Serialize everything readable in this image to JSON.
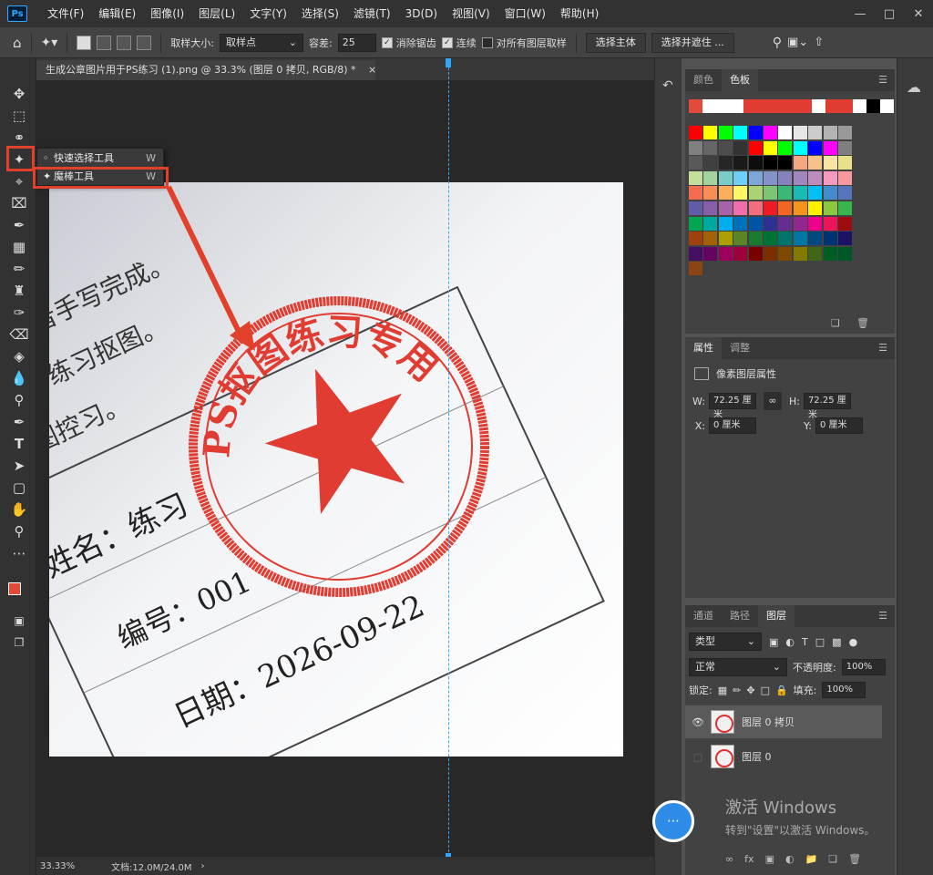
{
  "menubar": {
    "logo": "Ps",
    "items": [
      "文件(F)",
      "编辑(E)",
      "图像(I)",
      "图层(L)",
      "文字(Y)",
      "选择(S)",
      "滤镜(T)",
      "3D(D)",
      "视图(V)",
      "窗口(W)",
      "帮助(H)"
    ]
  },
  "options": {
    "sample_size_label": "取样大小:",
    "sample_size_value": "取样点",
    "tolerance_label": "容差:",
    "tolerance_value": "25",
    "antialias_label": "消除锯齿",
    "antialias_checked": true,
    "contiguous_label": "连续",
    "contiguous_checked": true,
    "all_layers_label": "对所有图层取样",
    "all_layers_checked": false,
    "select_subject": "选择主体",
    "select_mask": "选择并遮住 ..."
  },
  "document": {
    "tab_title": "生成公章图片用于PS练习 (1).png @ 33.3% (图层 0 拷贝, RGB/8) *",
    "close": "×"
  },
  "canvas_text": {
    "line1": "要求打字或者手写完成。",
    "line2": "用于练习练习抠图。",
    "line3": "手抄图控习。",
    "name": "姓名：练习",
    "number": "编号：001",
    "date": "日期：2026-09-22",
    "seal_text": "PS抠图练习专用"
  },
  "flyout": {
    "items": [
      {
        "label": "快速选择工具",
        "key": "W",
        "active": false
      },
      {
        "label": "魔棒工具",
        "key": "W",
        "active": true
      }
    ]
  },
  "status": {
    "zoom": "33.33%",
    "doc": "文档:12.0M/24.0M",
    "arrow": "›"
  },
  "swatch_panel": {
    "tabs": [
      "颜色",
      "色板"
    ],
    "active_tab": "色板",
    "recent": [
      "#e24a3b",
      "#ffffff",
      "#ffffff",
      "#ffffff",
      "#e03c31",
      "#e03c31",
      "#e03c31",
      "#e03c31",
      "#e03c31",
      "#ffffff",
      "#e03c31",
      "#e03c31",
      "#ffffff",
      "#000000",
      "#ffffff"
    ],
    "grid": [
      [
        "#ff0000",
        "#ffff00",
        "#00ff00",
        "#00ffff",
        "#0000ff",
        "#ff00ff",
        "#ffffff",
        "#e6e6e6",
        "#cccccc",
        "#b3b3b3",
        "#999999"
      ],
      [
        "#808080",
        "#666666",
        "#4d4d4d",
        "#333333",
        "#ff0000",
        "#ffff00",
        "#00ff00",
        "#00ffff",
        "#0000ff",
        "#ff00ff",
        "#7f7f7f"
      ],
      [
        "#595959",
        "#404040",
        "#262626",
        "#1a1a1a",
        "#0d0d0d",
        "#000000",
        "#000000",
        "#f4a582",
        "#f6c28b",
        "#fbe3a3",
        "#e8e08a"
      ],
      [
        "#c4df9b",
        "#a3d39c",
        "#7accc8",
        "#6dcff6",
        "#7da7d9",
        "#8393ca",
        "#8781bd",
        "#a186be",
        "#bd8cbf",
        "#f49ac1",
        "#f6989d"
      ],
      [
        "#f26c4f",
        "#f68e56",
        "#fbaf5d",
        "#fff568",
        "#acd372",
        "#7cc576",
        "#3bb878",
        "#1abbb4",
        "#00bff3",
        "#438ccb",
        "#5574b9"
      ],
      [
        "#605ca8",
        "#855fa8",
        "#a763a8",
        "#f06eaa",
        "#f26d7d",
        "#ed1c24",
        "#f26522",
        "#f7941d",
        "#fff200",
        "#8dc63f",
        "#39b54a"
      ],
      [
        "#00a651",
        "#00a99d",
        "#00aeef",
        "#0072bc",
        "#0054a6",
        "#2e3192",
        "#662d91",
        "#92278f",
        "#ec008c",
        "#ed145b",
        "#9e0b0f"
      ],
      [
        "#a0410d",
        "#a36209",
        "#aba000",
        "#598527",
        "#1a7b30",
        "#007236",
        "#00746b",
        "#0076a3",
        "#004a80",
        "#003471",
        "#1b1464"
      ],
      [
        "#440e62",
        "#630460",
        "#9e005d",
        "#9e0039",
        "#790000",
        "#7b2e00",
        "#7d4900",
        "#827b00",
        "#406618",
        "#005e20",
        "#005826"
      ],
      [
        "#8b4513"
      ]
    ]
  },
  "properties": {
    "tabs": [
      "属性",
      "调整"
    ],
    "active_tab": "属性",
    "type_label": "像素图层属性",
    "w_label": "W:",
    "w_value": "72.25 厘米",
    "h_label": "H:",
    "h_value": "72.25 厘米",
    "x_label": "X:",
    "x_value": "0 厘米",
    "y_label": "Y:",
    "y_value": "0 厘米"
  },
  "layers": {
    "tabs": [
      "通道",
      "路径",
      "图层"
    ],
    "active_tab": "图层",
    "filter_label": "类型",
    "blend_mode": "正常",
    "opacity_label": "不透明度:",
    "opacity_value": "100%",
    "lock_label": "锁定:",
    "fill_label": "填充:",
    "fill_value": "100%",
    "items": [
      {
        "name": "图层 0 拷贝",
        "visible": true,
        "selected": true
      },
      {
        "name": "图层 0",
        "visible": false,
        "selected": false
      }
    ]
  },
  "watermark": {
    "line1": "激活 Windows",
    "line2": "转到\"设置\"以激活 Windows。"
  }
}
